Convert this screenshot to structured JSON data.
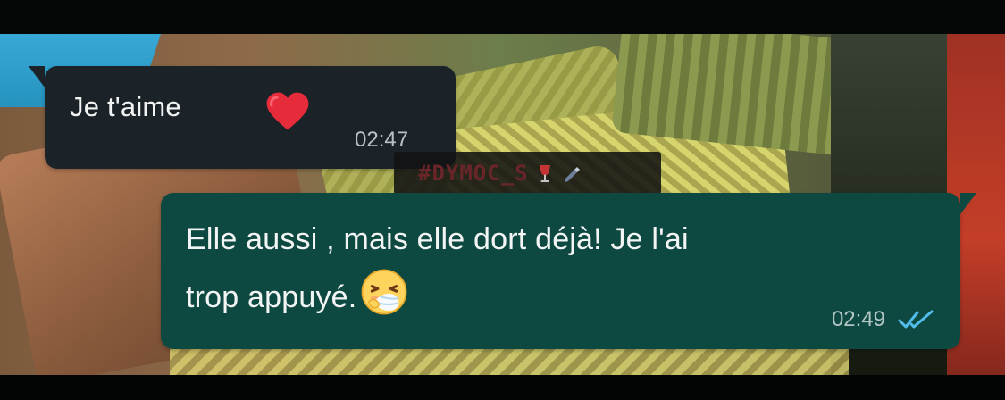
{
  "messages": [
    {
      "direction": "incoming",
      "text": "Je t'aime",
      "emoji_icon": "red-heart-icon",
      "time": "02:47"
    },
    {
      "direction": "outgoing",
      "line1": "Elle aussi , mais elle dort déjà! Je l'ai",
      "line2": "trop appuyé.",
      "emoji_icon": "sneezing-face-icon",
      "time": "02:49",
      "status_icon": "double-check-read-icon",
      "status_color": "#53bdeb"
    }
  ],
  "watermark": {
    "text": "#DYMOC_S",
    "icons": [
      "wine-glass-icon",
      "pen-icon"
    ]
  },
  "colors": {
    "incoming_bubble": "#1b2329",
    "outgoing_bubble": "#0d4941",
    "message_text": "#f3f5f5",
    "watermark_text": "#6a2529"
  }
}
